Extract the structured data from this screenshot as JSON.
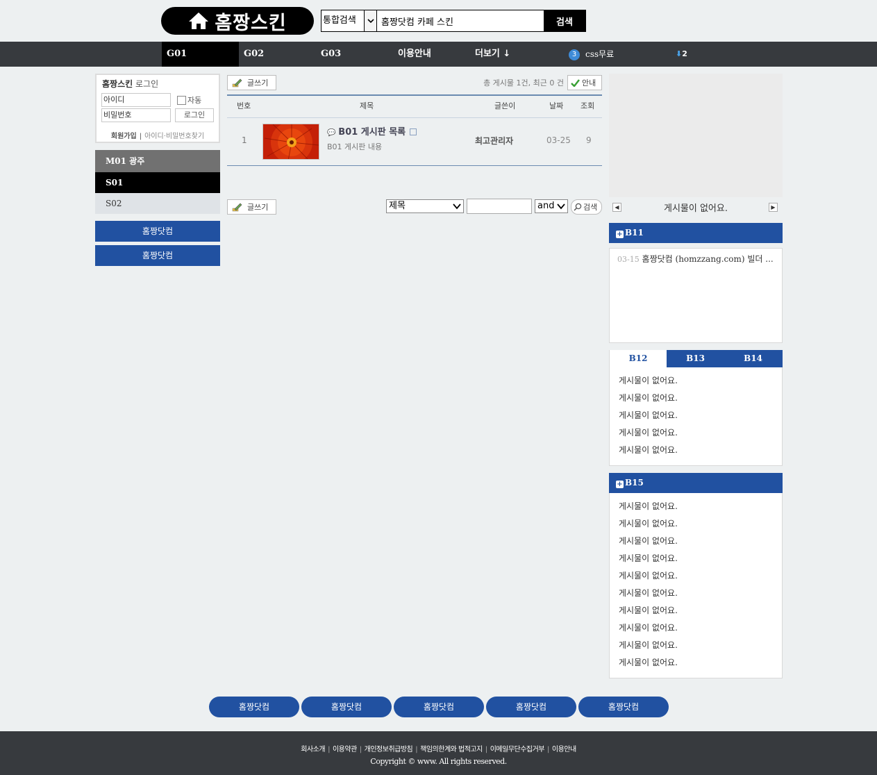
{
  "header": {
    "logo_text": "홈짱스킨",
    "search": {
      "scope_value": "통합검색",
      "query_value": "홈짱닷컴 카페 스킨",
      "button_label": "검색"
    }
  },
  "nav": {
    "items": [
      {
        "label": "G01"
      },
      {
        "label": "G02"
      },
      {
        "label": "G03"
      },
      {
        "label": "이용안내"
      },
      {
        "label": "더보기 ↓"
      }
    ],
    "badge_count": "3",
    "badge_label": "css무료",
    "down_count": "2"
  },
  "login": {
    "title_bold": "홈짱스킨",
    "title_rest": " 로그인",
    "id_placeholder": "아이디",
    "pw_placeholder": "비밀번호",
    "auto_label": "자동",
    "login_button": "로그인",
    "signup_link": "회원가입",
    "find_link": "아이디·비밀번호찾기"
  },
  "side_menu": {
    "heading": "M01 광주",
    "items": [
      {
        "label": "S01"
      },
      {
        "label": "S02"
      }
    ],
    "buttons": [
      {
        "label": "홈짱닷컴"
      },
      {
        "label": "홈짱닷컴"
      }
    ]
  },
  "board": {
    "write_label": "글쓰기",
    "count_text": "총 게시물 1건, 최근 0 건",
    "guide_label": "안내",
    "columns": {
      "num": "번호",
      "title": "제목",
      "author": "글쓴이",
      "date": "날짜",
      "views": "조회"
    },
    "rows": [
      {
        "num": "1",
        "title": "B01 게시판 목록",
        "excerpt": "B01 게시판 내용",
        "author": "최고관리자",
        "date": "03-25",
        "views": "9"
      }
    ],
    "search": {
      "field_value": "제목",
      "op_value": "and",
      "button_label": "검색"
    }
  },
  "right": {
    "slider_text": "게시물이 없어요.",
    "panel_b11": {
      "title": "B11",
      "items": [
        {
          "date": "03-15",
          "text": "홈짱닷컴 (homzzang.com) 빌더 ..."
        }
      ]
    },
    "tabs": [
      {
        "label": "B12"
      },
      {
        "label": "B13"
      },
      {
        "label": "B14"
      }
    ],
    "tab_items": [
      "게시물이 없어요.",
      "게시물이 없어요.",
      "게시물이 없어요.",
      "게시물이 없어요.",
      "게시물이 없어요."
    ],
    "panel_b15": {
      "title": "B15",
      "items": [
        "게시물이 없어요.",
        "게시물이 없어요.",
        "게시물이 없어요.",
        "게시물이 없어요.",
        "게시물이 없어요.",
        "게시물이 없어요.",
        "게시물이 없어요.",
        "게시물이 없어요.",
        "게시물이 없어요.",
        "게시물이 없어요."
      ]
    }
  },
  "bottom_buttons": [
    "홈짱닷컴",
    "홈짱닷컴",
    "홈짱닷컴",
    "홈짱닷컴",
    "홈짱닷컴"
  ],
  "footer": {
    "links": [
      "회사소개",
      "이용약관",
      "개인정보취급방침",
      "책임의한계와 법적고지",
      "이메일무단수집거부",
      "이용안내"
    ],
    "copyright": "Copyright © www. All rights reserved."
  },
  "colors": {
    "brand_blue": "#2151a1",
    "nav_dark": "#373a3e",
    "background": "#edf0f1"
  }
}
